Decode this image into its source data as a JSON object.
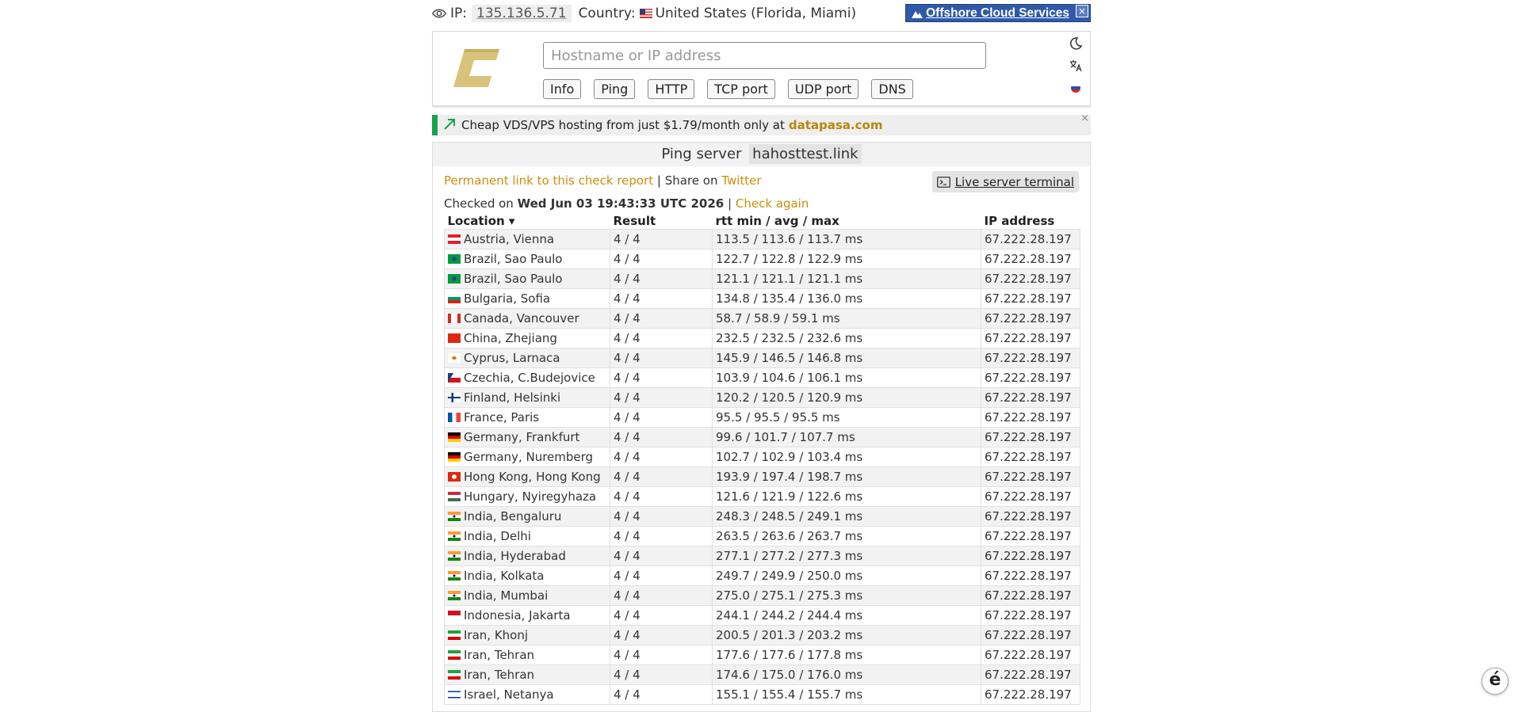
{
  "topbar": {
    "ip_label": "IP:",
    "ip_value": "135.136.5.71",
    "country_label": "Country:",
    "country_value": "United States (Florida, Miami)",
    "offshore_label": "Offshore Cloud Services",
    "offshore_close": "×"
  },
  "header": {
    "search_placeholder": "Hostname or IP address",
    "buttons": [
      "Info",
      "Ping",
      "HTTP",
      "TCP port",
      "UDP port",
      "DNS"
    ],
    "icons": [
      "moon-icon",
      "translate-icon",
      "russian-flag-icon"
    ]
  },
  "ad": {
    "text": "Cheap VDS/VPS hosting from just $1.79/month only at",
    "brand": "datapasa.com",
    "close": "×",
    "accent": "#18a34a"
  },
  "report": {
    "title_prefix": "Ping server",
    "host": "hahosttest.link",
    "permalink": "Permanent link to this check report",
    "separator": "|",
    "share_prefix": "Share on",
    "share_link": "Twitter",
    "terminal": "Live server terminal",
    "checked_prefix": "Checked on",
    "checked_date": "Wed Jun 03 19:43:33 UTC 2026",
    "check_again": "Check again",
    "columns": [
      "Location ▾",
      "Result",
      "rtt min / avg / max",
      "IP address"
    ],
    "rows": [
      {
        "flag": "at",
        "location": "Austria, Vienna",
        "result": "4 / 4",
        "rtt": "113.5 / 113.6 / 113.7 ms",
        "ip": "67.222.28.197"
      },
      {
        "flag": "br",
        "location": "Brazil, Sao Paulo",
        "result": "4 / 4",
        "rtt": "122.7 / 122.8 / 122.9 ms",
        "ip": "67.222.28.197"
      },
      {
        "flag": "br",
        "location": "Brazil, Sao Paulo",
        "result": "4 / 4",
        "rtt": "121.1 / 121.1 / 121.1 ms",
        "ip": "67.222.28.197"
      },
      {
        "flag": "bg",
        "location": "Bulgaria, Sofia",
        "result": "4 / 4",
        "rtt": "134.8 / 135.4 / 136.0 ms",
        "ip": "67.222.28.197"
      },
      {
        "flag": "ca",
        "location": "Canada, Vancouver",
        "result": "4 / 4",
        "rtt": "58.7 / 58.9 / 59.1 ms",
        "ip": "67.222.28.197"
      },
      {
        "flag": "cn",
        "location": "China, Zhejiang",
        "result": "4 / 4",
        "rtt": "232.5 / 232.5 / 232.6 ms",
        "ip": "67.222.28.197"
      },
      {
        "flag": "cy",
        "location": "Cyprus, Larnaca",
        "result": "4 / 4",
        "rtt": "145.9 / 146.5 / 146.8 ms",
        "ip": "67.222.28.197"
      },
      {
        "flag": "cz",
        "location": "Czechia, C.Budejovice",
        "result": "4 / 4",
        "rtt": "103.9 / 104.6 / 106.1 ms",
        "ip": "67.222.28.197"
      },
      {
        "flag": "fi",
        "location": "Finland, Helsinki",
        "result": "4 / 4",
        "rtt": "120.2 / 120.5 / 120.9 ms",
        "ip": "67.222.28.197"
      },
      {
        "flag": "fr",
        "location": "France, Paris",
        "result": "4 / 4",
        "rtt": "95.5 / 95.5 / 95.5 ms",
        "ip": "67.222.28.197"
      },
      {
        "flag": "de",
        "location": "Germany, Frankfurt",
        "result": "4 / 4",
        "rtt": "99.6 / 101.7 / 107.7 ms",
        "ip": "67.222.28.197"
      },
      {
        "flag": "de",
        "location": "Germany, Nuremberg",
        "result": "4 / 4",
        "rtt": "102.7 / 102.9 / 103.4 ms",
        "ip": "67.222.28.197"
      },
      {
        "flag": "hk",
        "location": "Hong Kong, Hong Kong",
        "result": "4 / 4",
        "rtt": "193.9 / 197.4 / 198.7 ms",
        "ip": "67.222.28.197"
      },
      {
        "flag": "hu",
        "location": "Hungary, Nyiregyhaza",
        "result": "4 / 4",
        "rtt": "121.6 / 121.9 / 122.6 ms",
        "ip": "67.222.28.197"
      },
      {
        "flag": "in",
        "location": "India, Bengaluru",
        "result": "4 / 4",
        "rtt": "248.3 / 248.5 / 249.1 ms",
        "ip": "67.222.28.197"
      },
      {
        "flag": "in",
        "location": "India, Delhi",
        "result": "4 / 4",
        "rtt": "263.5 / 263.6 / 263.7 ms",
        "ip": "67.222.28.197"
      },
      {
        "flag": "in",
        "location": "India, Hyderabad",
        "result": "4 / 4",
        "rtt": "277.1 / 277.2 / 277.3 ms",
        "ip": "67.222.28.197"
      },
      {
        "flag": "in",
        "location": "India, Kolkata",
        "result": "4 / 4",
        "rtt": "249.7 / 249.9 / 250.0 ms",
        "ip": "67.222.28.197"
      },
      {
        "flag": "in",
        "location": "India, Mumbai",
        "result": "4 / 4",
        "rtt": "275.0 / 275.1 / 275.3 ms",
        "ip": "67.222.28.197"
      },
      {
        "flag": "id",
        "location": "Indonesia, Jakarta",
        "result": "4 / 4",
        "rtt": "244.1 / 244.2 / 244.4 ms",
        "ip": "67.222.28.197"
      },
      {
        "flag": "ir",
        "location": "Iran, Khonj",
        "result": "4 / 4",
        "rtt": "200.5 / 201.3 / 203.2 ms",
        "ip": "67.222.28.197"
      },
      {
        "flag": "ir",
        "location": "Iran, Tehran",
        "result": "4 / 4",
        "rtt": "177.6 / 177.6 / 177.8 ms",
        "ip": "67.222.28.197"
      },
      {
        "flag": "ir",
        "location": "Iran, Tehran",
        "result": "4 / 4",
        "rtt": "174.6 / 175.0 / 176.0 ms",
        "ip": "67.222.28.197"
      },
      {
        "flag": "il",
        "location": "Israel, Netanya",
        "result": "4 / 4",
        "rtt": "155.1 / 155.4 / 155.7 ms",
        "ip": "67.222.28.197"
      }
    ]
  },
  "float_button": "é"
}
